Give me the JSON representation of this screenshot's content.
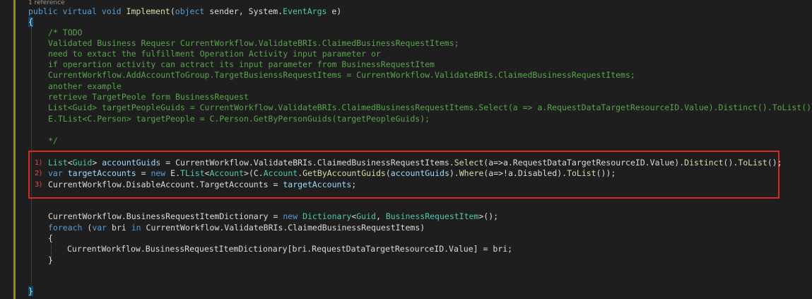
{
  "editor": {
    "codelens": "1 reference",
    "signature": {
      "kw1": "public",
      "kw2": "virtual",
      "kw3": "void",
      "method": "Implement",
      "open": "(",
      "kw4": "object",
      "p1": " sender, System.",
      "type": "EventArgs",
      "p2": " e)"
    },
    "open_brace": "{",
    "comment_lines": [
      "/* TODO",
      "Validated Business Requesr CurrentWorkflow.ValidateBRIs.ClaimedBusinessRequestItems;",
      "need to extact the fulfillment Operation Activity input parameter or",
      "if operartion activity can actract its input parameter from BusinessRequestItem",
      "CurrentWorkflow.AddAccountToGroup.TargetBusienssRequestItems = CurrentWorkflow.ValidateBRIs.ClaimedBusinessRequestItems;",
      "another example",
      "retrieve TargetPeole form BusinessRequest",
      "List<Guid> targetPeopleGuids = CurrentWorkflow.ValidateBRIs.ClaimedBusinessRequestItems.Select(a => a.RequestDataTargetResourceID.Value).Distinct().ToList();",
      "E.TList<C.Person> targetPeople = C.Person.GetByPersonGuids(targetPeopleGuids);",
      "",
      "*/"
    ],
    "markers": [
      "1)",
      "2)",
      "3)"
    ],
    "hl1": {
      "t1": "List",
      "t2": "<",
      "t3": "Guid",
      "t4": "> ",
      "t5": "accountGuids",
      "t6": " = CurrentWorkflow.ValidateBRIs.ClaimedBusinessRequestItems.",
      "t7": "Select",
      "t8": "(a=>a.RequestDataTargetResourceID.Value).",
      "t9": "Distinct",
      "t10": "().",
      "t11": "ToList",
      "t12": "();"
    },
    "hl2": {
      "t1": "var",
      "t2": " ",
      "t3": "targetAccounts",
      "t4": " = ",
      "t5": "new",
      "t6": " E.",
      "t7": "TList",
      "t8": "<",
      "t9": "Account",
      "t10": ">(C.",
      "t11": "Account",
      "t12": ".",
      "t13": "GetByAccountGuids",
      "t14": "(",
      "t15": "accountGuids",
      "t16": ").",
      "t17": "Where",
      "t18": "(a=>!a.Disabled).",
      "t19": "ToList",
      "t20": "());"
    },
    "hl3": {
      "t1": "CurrentWorkflow.DisableAccount.TargetAccounts = ",
      "t2": "targetAccounts",
      "t3": ";"
    },
    "dict_line": {
      "t1": "CurrentWorkflow.BusinessRequestItemDictionary = ",
      "t2": "new",
      "t3": " ",
      "t4": "Dictionary",
      "t5": "<",
      "t6": "Guid",
      "t7": ", ",
      "t8": "BusinessRequestItem",
      "t9": ">();"
    },
    "foreach_line": {
      "t1": "foreach",
      "t2": " (",
      "t3": "var",
      "t4": " bri ",
      "t5": "in",
      "t6": " CurrentWorkflow.ValidateBRIs.ClaimedBusinessRequestItems)"
    },
    "inner_open": "{",
    "assign_line": {
      "t1": "CurrentWorkflow.BusinessRequestItemDictionary[bri.RequestDataTargetResourceID.Value] = bri;"
    },
    "inner_close": "}",
    "close_brace": "}"
  }
}
